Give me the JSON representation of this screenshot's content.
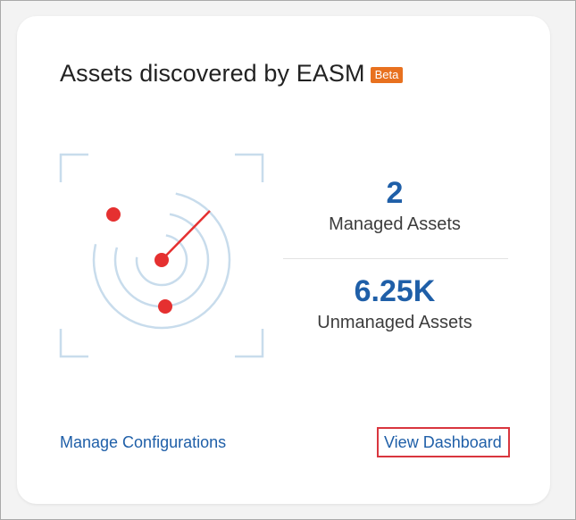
{
  "card": {
    "title": "Assets discovered by EASM",
    "badge": "Beta"
  },
  "stats": {
    "managed": {
      "value": "2",
      "label": "Managed Assets"
    },
    "unmanaged": {
      "value": "6.25K",
      "label": "Unmanaged Assets"
    }
  },
  "links": {
    "manage_configurations": "Manage Configurations",
    "view_dashboard": "View Dashboard"
  },
  "icons": {
    "radar": "radar-icon"
  },
  "colors": {
    "accent": "#1f5fa8",
    "badge": "#e8711f",
    "highlight_border": "#d9363e",
    "radar_dot": "#e53030",
    "radar_ring": "#c8dcec"
  }
}
